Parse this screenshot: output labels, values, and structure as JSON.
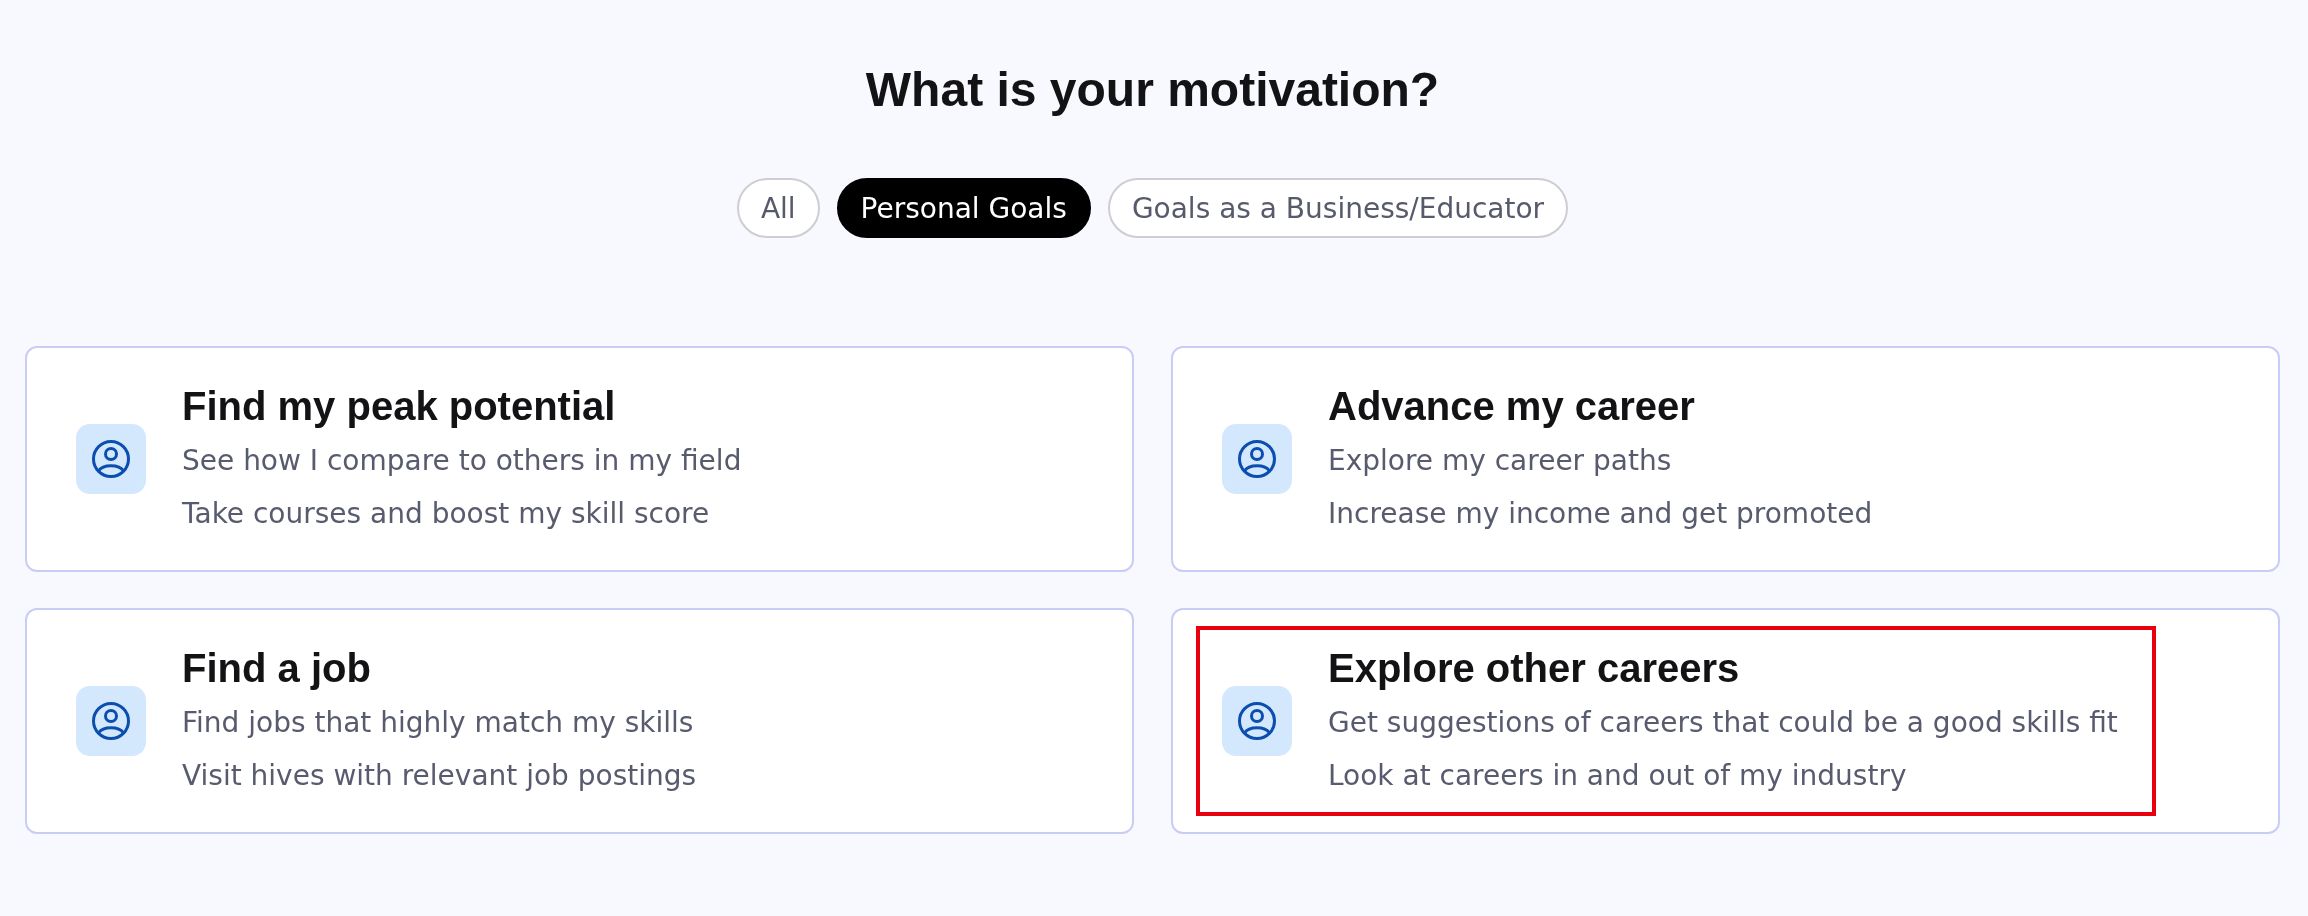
{
  "heading": "What is your motivation?",
  "filters": [
    {
      "label": "All",
      "selected": false
    },
    {
      "label": "Personal Goals",
      "selected": true
    },
    {
      "label": "Goals as a Business/Educator",
      "selected": false
    }
  ],
  "options": [
    {
      "title": "Find my peak potential",
      "lines": [
        "See how I compare to others in my field",
        "Take courses and boost my skill score"
      ],
      "highlighted": false
    },
    {
      "title": "Advance my career",
      "lines": [
        "Explore my career paths",
        "Increase my income and get promoted"
      ],
      "highlighted": false
    },
    {
      "title": "Find a job",
      "lines": [
        "Find jobs that highly match my skills",
        "Visit hives with relevant job postings"
      ],
      "highlighted": false
    },
    {
      "title": "Explore other careers",
      "lines": [
        "Get suggestions of careers that could be a good skills fit",
        "Look at careers in and out of my industry"
      ],
      "highlighted": true
    }
  ]
}
